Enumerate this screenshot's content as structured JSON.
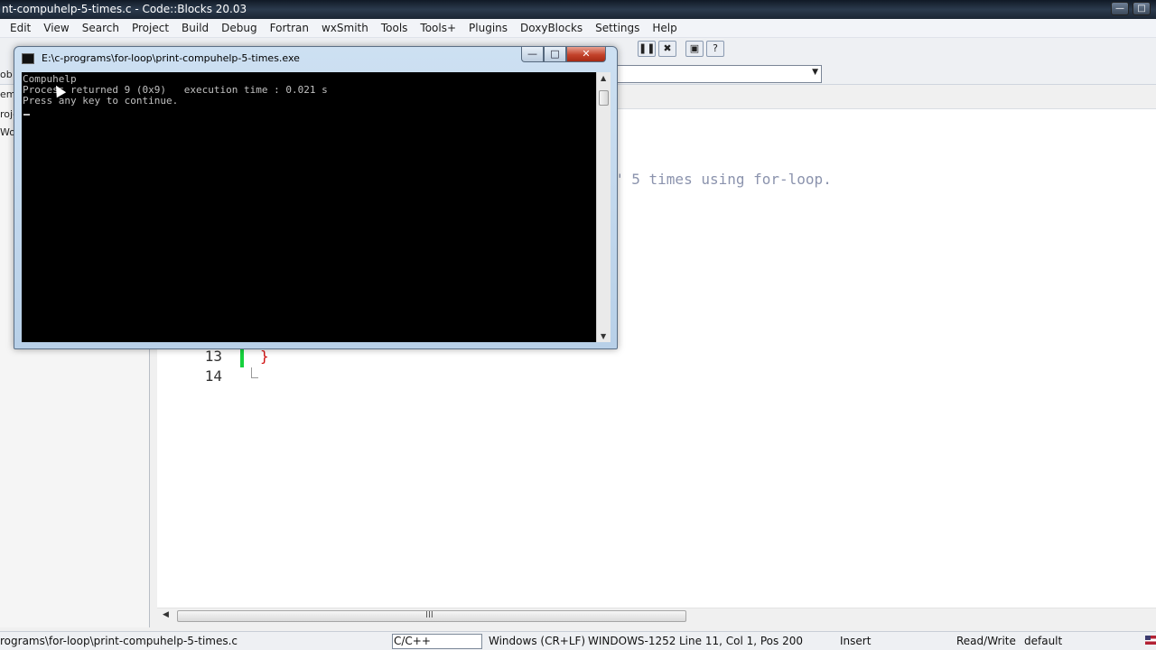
{
  "ide": {
    "title": "nt-compuhelp-5-times.c - Code::Blocks 20.03",
    "window_buttons": [
      "—",
      "□"
    ]
  },
  "menu": [
    "Edit",
    "View",
    "Search",
    "Project",
    "Build",
    "Debug",
    "Fortran",
    "wxSmith",
    "Tools",
    "Tools+",
    "Plugins",
    "DoxyBlocks",
    "Settings",
    "Help"
  ],
  "toolbar": {
    "pause_icon": "pause-icon",
    "stop_icon": "stop-icon",
    "tool_icon": "debug-window-icon",
    "info_icon": "info-icon",
    "pause_glyph": "❚❚",
    "stop_glyph": "✖",
    "debug_glyph": "▣",
    "info_glyph": "?"
  },
  "left_panel": {
    "labels": [
      "ob",
      "em",
      "roje",
      "Wo"
    ]
  },
  "editor": {
    "line_numbers": [
      "13",
      "14"
    ],
    "closing_brace": "}",
    "comment_fragment": "\" 5 times using for-loop."
  },
  "console": {
    "title": "E:\\c-programs\\for-loop\\print-compuhelp-5-times.exe",
    "buttons": {
      "minimize": "—",
      "maximize": "□",
      "close": "✕"
    },
    "output_lines": [
      "Compuhelp",
      "Process returned 9 (0x9)   execution time : 0.021 s",
      "Press any key to continue."
    ]
  },
  "hscroll": {
    "grip": "III"
  },
  "statusbar": {
    "path": "rograms\\for-loop\\print-compuhelp-5-times.c",
    "language": "C/C++",
    "line_endings": "Windows (CR+LF)",
    "encoding": "WINDOWS-1252",
    "position": "Line 11, Col 1, Pos 200",
    "mode": "Insert",
    "access": "Read/Write",
    "profile": "default"
  },
  "colors": {
    "accent_title": "#1b2533",
    "console_bg": "#000000",
    "console_text": "#c0c0c0",
    "change_marker": "#16d13d",
    "brace": "#d01010",
    "comment": "#8b93ad"
  }
}
